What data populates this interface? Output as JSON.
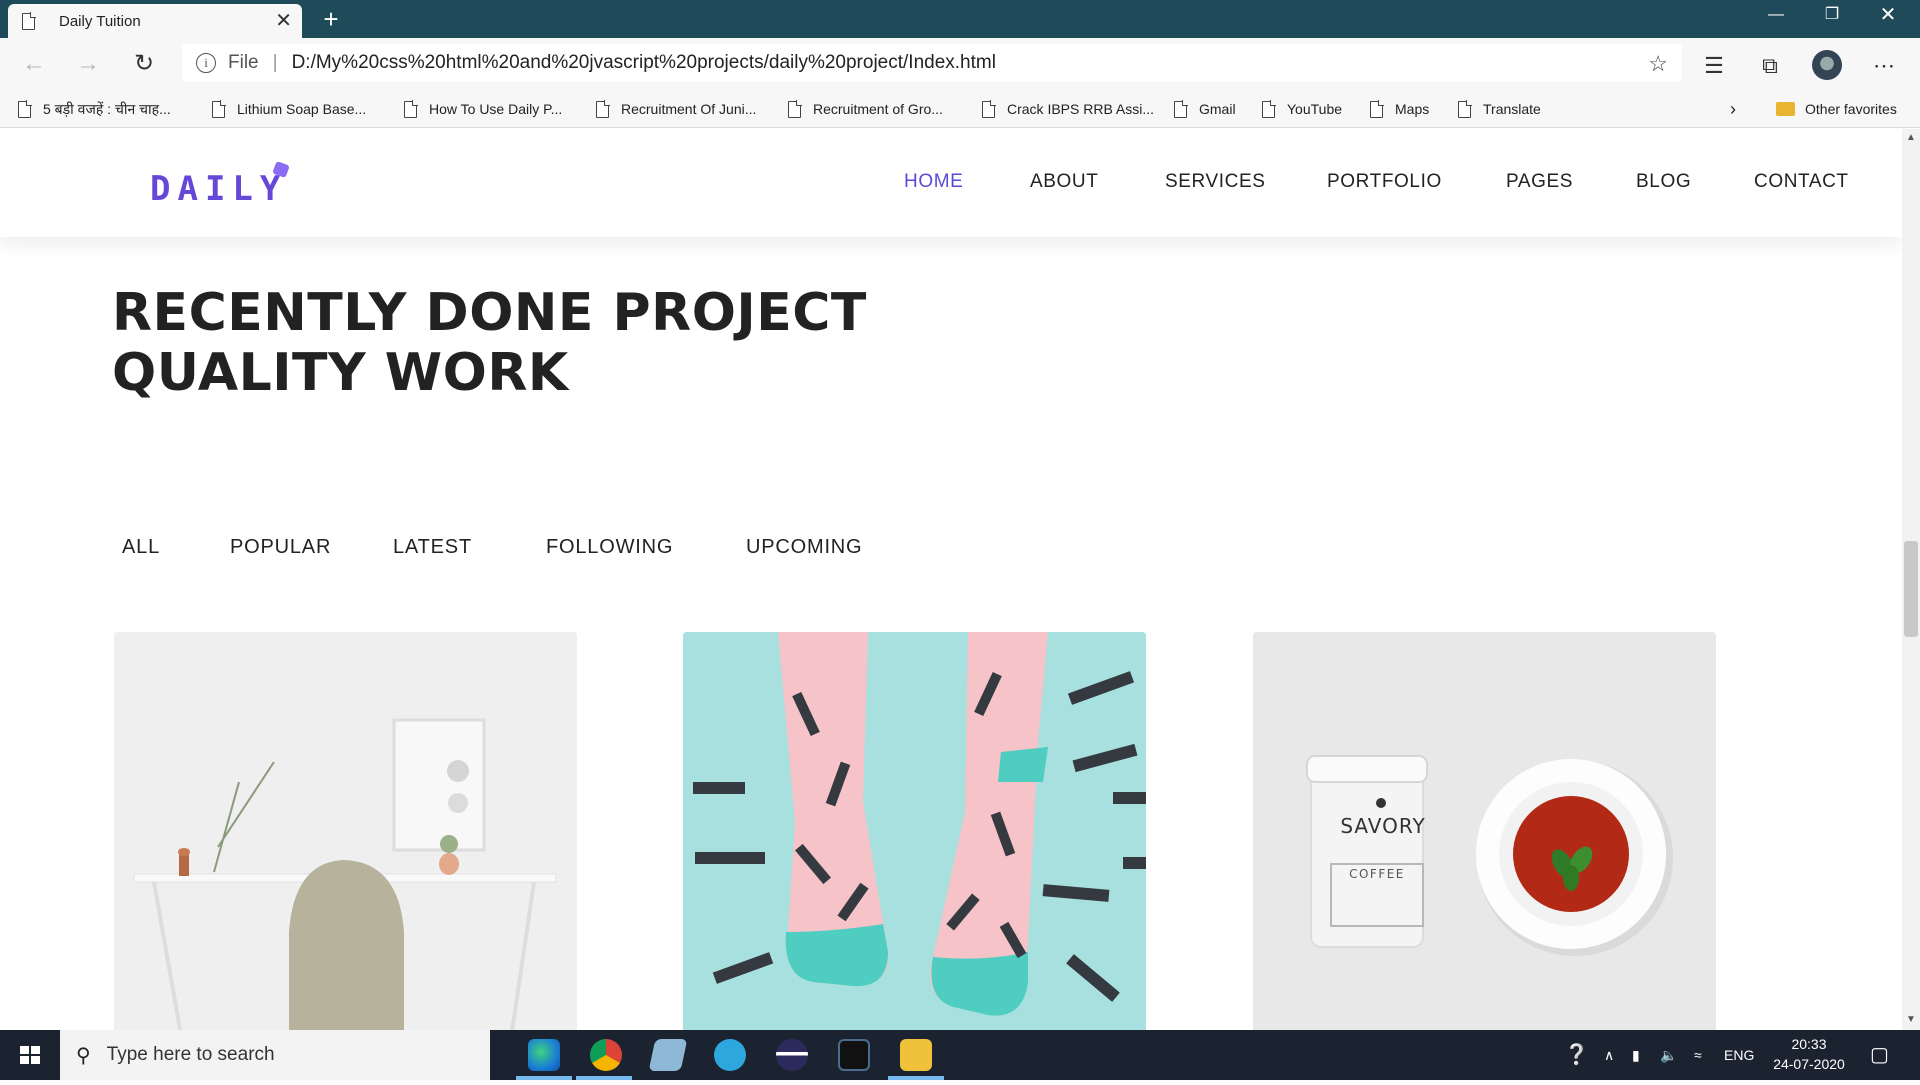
{
  "browser": {
    "tab_title": "Daily Tuition",
    "tab_close": "✕",
    "new_tab": "+",
    "url_scheme": "File",
    "url": "D:/My%20css%20html%20and%20jvascript%20projects/daily%20project/Index.html",
    "bookmarks": [
      "5 बड़ी वजहें : चीन चाह...",
      "Lithium Soap Base...",
      "How To Use Daily P...",
      "Recruitment Of Juni...",
      "Recruitment of Gro...",
      "Crack IBPS RRB Assi...",
      "Gmail",
      "YouTube",
      "Maps",
      "Translate"
    ],
    "other_favorites": "Other favorites"
  },
  "site": {
    "logo": "DAILY",
    "nav": [
      {
        "label": "HOME",
        "active": true
      },
      {
        "label": "ABOUT",
        "active": false
      },
      {
        "label": "SERVICES",
        "active": false
      },
      {
        "label": "PORTFOLIO",
        "active": false
      },
      {
        "label": "PAGES",
        "active": false
      },
      {
        "label": "BLOG",
        "active": false
      },
      {
        "label": "CONTACT",
        "active": false
      }
    ],
    "heading_line1": "RECENTLY DONE PROJECT",
    "heading_line2": "QUALITY WORK",
    "filters": [
      "ALL",
      "POPULAR",
      "LATEST",
      "FOLLOWING",
      "UPCOMING"
    ],
    "card3_brand": "SAVORY",
    "card3_label": "COFFEE",
    "accent_color": "#5a4ad6"
  },
  "taskbar": {
    "search_placeholder": "Type here to search",
    "lang": "ENG",
    "time": "20:33",
    "date": "24-07-2020"
  }
}
